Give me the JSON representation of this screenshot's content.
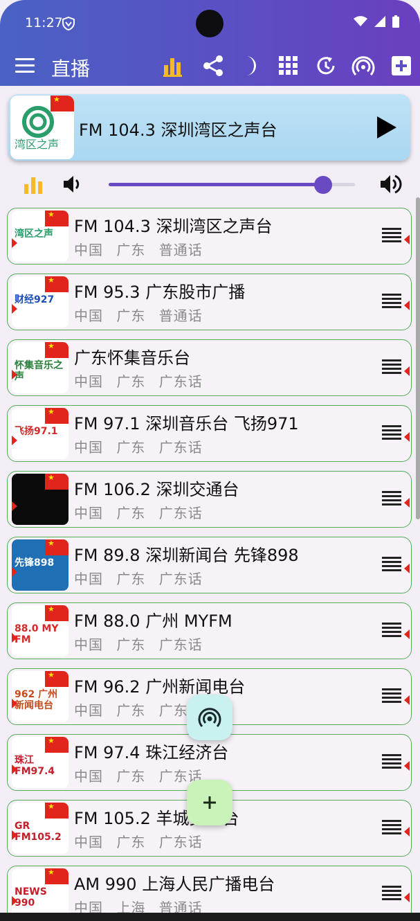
{
  "status": {
    "time": "11:27"
  },
  "appbar": {
    "title": "直播",
    "icons": [
      "menu-icon",
      "equalizer-icon",
      "share-icon",
      "night-mode-icon",
      "grid-icon",
      "sleep-timer-icon",
      "cast-icon",
      "add-box-icon"
    ]
  },
  "now_playing": {
    "title": "FM 104.3 深圳湾区之声台"
  },
  "volume": {
    "level": 0.87
  },
  "stations": [
    {
      "title": "FM 104.3 深圳湾区之声台",
      "country": "中国",
      "region": "广东",
      "language": "普通话",
      "logo_text": "湾区之声"
    },
    {
      "title": "FM 95.3 广东股市广播",
      "country": "中国",
      "region": "广东",
      "language": "普通话",
      "logo_text": "财经927"
    },
    {
      "title": "广东怀集音乐台",
      "country": "中国",
      "region": "广东",
      "language": "广东话",
      "logo_text": "怀集音乐之声"
    },
    {
      "title": "FM 97.1 深圳音乐台 飞扬971",
      "country": "中国",
      "region": "广东",
      "language": "广东话",
      "logo_text": "飞扬97.1"
    },
    {
      "title": "FM 106.2 深圳交通台",
      "country": "中国",
      "region": "广东",
      "language": "广东话",
      "logo_text": ""
    },
    {
      "title": "FM 89.8 深圳新闻台 先锋898",
      "country": "中国",
      "region": "广东",
      "language": "广东话",
      "logo_text": "先锋898"
    },
    {
      "title": "FM 88.0 广州 MYFM",
      "country": "中国",
      "region": "广东",
      "language": "广东话",
      "logo_text": "88.0 MY FM"
    },
    {
      "title": "FM 96.2 广州新闻电台",
      "country": "中国",
      "region": "广东",
      "language": "广东话",
      "logo_text": "962 广州新闻电台"
    },
    {
      "title": "FM 97.4 珠江经济台",
      "country": "中国",
      "region": "广东",
      "language": "广东话",
      "logo_text": "珠江 FM97.4"
    },
    {
      "title": "FM 105.2 羊城交通台",
      "country": "中国",
      "region": "广东",
      "language": "广东话",
      "logo_text": "GR FM105.2"
    },
    {
      "title": "AM 990 上海人民广播电台",
      "country": "中国",
      "region": "上海",
      "language": "普通话",
      "logo_text": "NEWS 990"
    }
  ],
  "fabs": [
    "cast-icon",
    "add-icon"
  ],
  "colors": {
    "accent": "#6a4ac2",
    "row_border": "#52ad58",
    "flag": "#e2251c"
  }
}
